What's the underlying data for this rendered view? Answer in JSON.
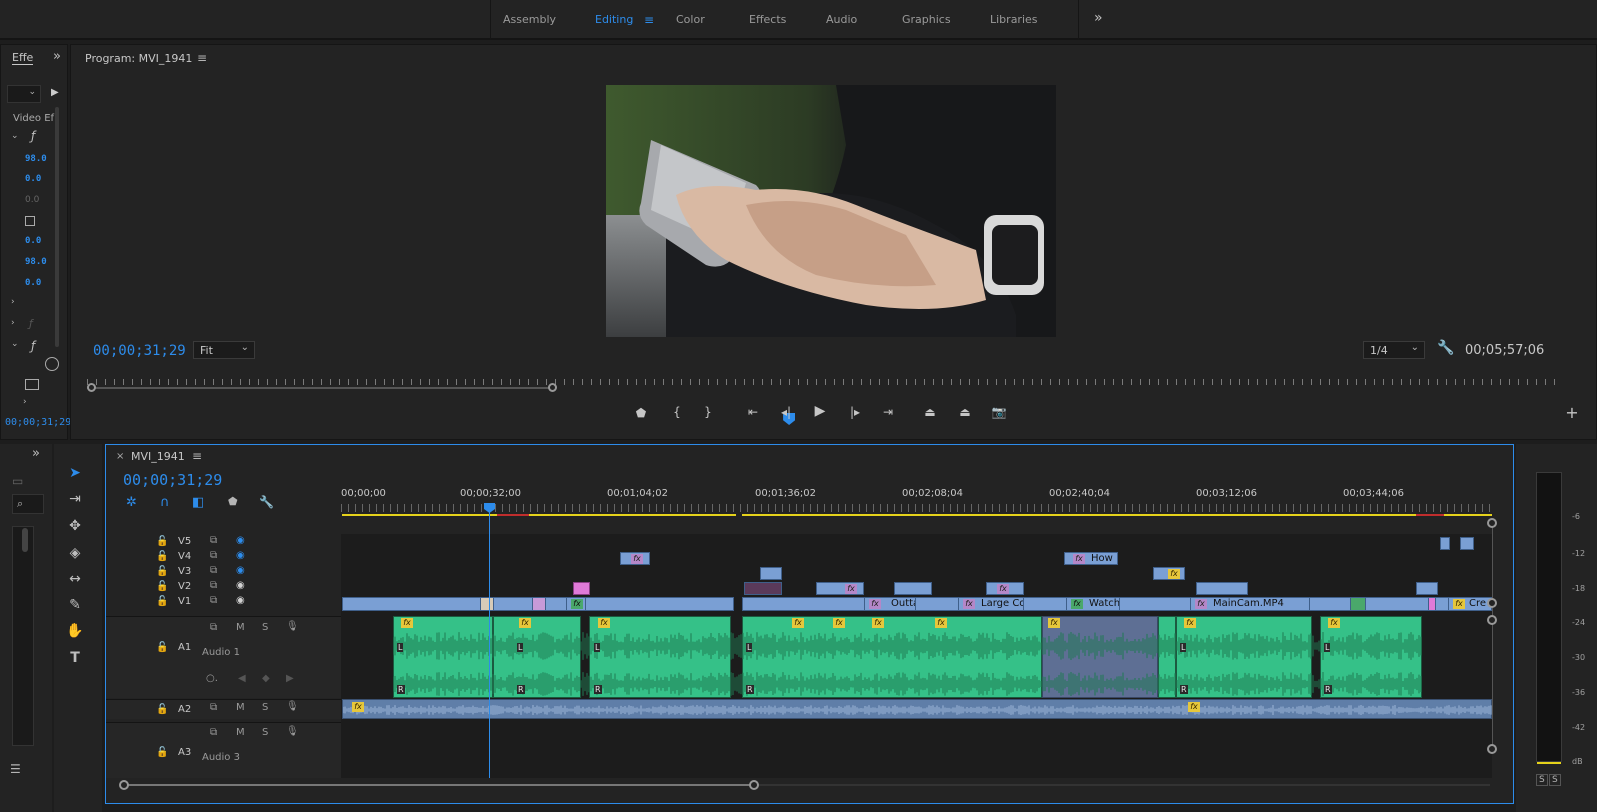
{
  "workspaces": [
    "Assembly",
    "Editing",
    "Color",
    "Effects",
    "Audio",
    "Graphics",
    "Libraries"
  ],
  "workspace_active": "Editing",
  "overflow_glyph": "»",
  "effects_panel": {
    "tab_label": "Effe",
    "subheader": "Video Ef",
    "values": [
      "98.0",
      "0.0",
      "0.0",
      "0.0",
      "98.0",
      "0.0"
    ],
    "footer_timecode": "00;00;31;29"
  },
  "program_monitor": {
    "title": "Program: MVI_1941",
    "timecode": "00;00;31;29",
    "zoom": "Fit",
    "resolution": "1/4",
    "duration": "00;05;57;06",
    "playhead_fraction": 0.43
  },
  "timeline": {
    "sequence_name": "MVI_1941",
    "timecode": "00;00;31;29",
    "ruler_ticks": [
      "00;00;00",
      "00;00;32;00",
      "00;01;04;02",
      "00;01;36;02",
      "00;02;08;04",
      "00;02;40;04",
      "00;03;12;06",
      "00;03;44;06"
    ],
    "video_tracks": [
      "V5",
      "V4",
      "V3",
      "V2",
      "V1"
    ],
    "audio_tracks": [
      {
        "id": "A1",
        "name": "Audio 1"
      },
      {
        "id": "A2",
        "name": ""
      },
      {
        "id": "A3",
        "name": "Audio 3"
      }
    ],
    "track_buttons": {
      "mute": "M",
      "solo": "S"
    },
    "clip_labels": [
      "How",
      "Outta",
      "Large Co",
      "Watch",
      "MainCam.MP4",
      "Cre"
    ],
    "fx_label": "fx",
    "channel_left": "L",
    "channel_right": "R"
  },
  "meter": {
    "scale": [
      "-6",
      "-12",
      "-18",
      "-24",
      "-30",
      "-36",
      "-42",
      "dB"
    ],
    "solo_labels": [
      "S",
      "S"
    ]
  },
  "colors": {
    "accent": "#2d8ceb",
    "video_clip": "#7a9fd4",
    "audio_clip": "#35c188",
    "pink_clip": "#e07ad8",
    "fx_badge": "#e6c73b",
    "work_area": "#e5d21b"
  }
}
